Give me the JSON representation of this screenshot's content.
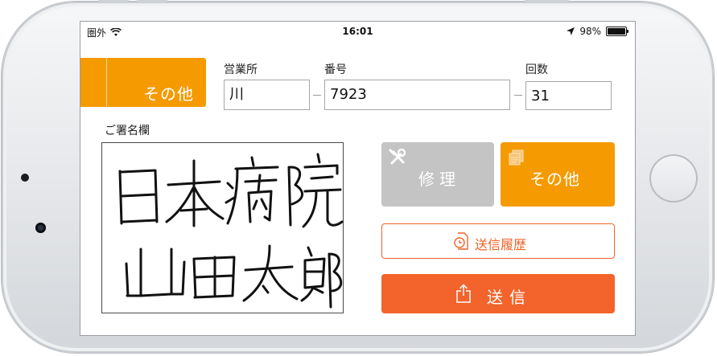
{
  "status_bar": {
    "carrier": "圏外",
    "time": "16:01",
    "battery": "98%",
    "battery_level": 0.98,
    "icons": [
      "wifi-icon",
      "location-arrow-icon",
      "battery-icon"
    ]
  },
  "category_button": {
    "label": "その他"
  },
  "fields": {
    "office": {
      "label": "営業所",
      "value": "川"
    },
    "number": {
      "label": "番号",
      "value": "7923"
    },
    "count": {
      "label": "回数",
      "value": "31"
    }
  },
  "signature": {
    "label": "ご署名欄",
    "handwriting": "日本病院 山田太郎"
  },
  "buttons": {
    "repair": {
      "label": "修理",
      "icon": "wrench-screwdriver-icon"
    },
    "other": {
      "label": "その他",
      "icon": "documents-icon"
    },
    "history": {
      "label": "送信履歴",
      "icon": "clock-document-icon"
    },
    "send": {
      "label": "送信",
      "icon": "share-upload-icon"
    }
  },
  "colors": {
    "orange": "#f59a00",
    "send_orange": "#f2642b",
    "gray_button": "#c4c4c4"
  }
}
